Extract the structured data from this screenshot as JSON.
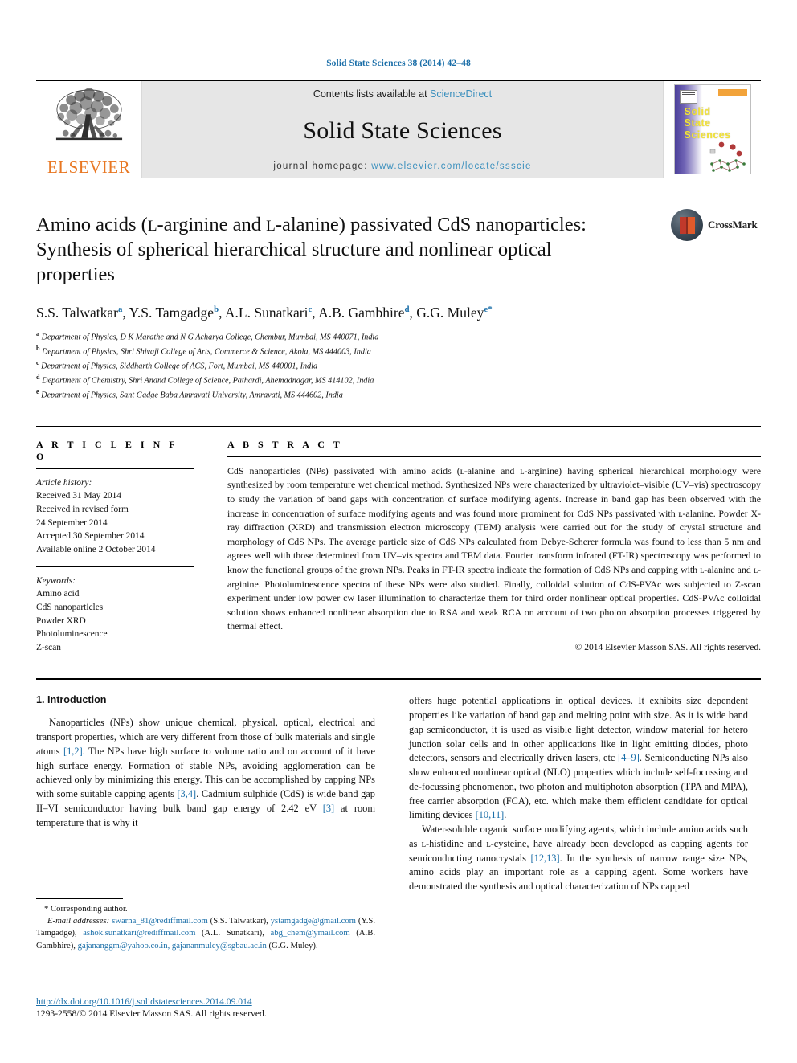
{
  "running_head": "Solid State Sciences 38 (2014) 42–48",
  "masthead": {
    "publisher_name": "ELSEVIER",
    "contents_prefix": "Contents lists available at ",
    "contents_link": "ScienceDirect",
    "journal_title": "Solid State Sciences",
    "homepage_label": "journal homepage:",
    "homepage_url": "www.elsevier.com/locate/ssscie",
    "cover_title": "Solid State Sciences"
  },
  "crossmark": {
    "label": "CrossMark"
  },
  "article": {
    "title_line1": "Amino acids (",
    "title_smallcap1": "L",
    "title_line1b": "-arginine and ",
    "title_smallcap2": "L",
    "title_line1c": "-alanine) passivated CdS nanoparticles:",
    "title_line2": "Synthesis of spherical hierarchical structure and nonlinear optical",
    "title_line3": "properties",
    "authors": [
      {
        "name": "S.S. Talwatkar",
        "mark": "a"
      },
      {
        "name": "Y.S. Tamgadge",
        "mark": "b"
      },
      {
        "name": "A.L. Sunatkari",
        "mark": "c"
      },
      {
        "name": "A.B. Gambhire",
        "mark": "d"
      },
      {
        "name": "G.G. Muley",
        "mark": "e",
        "star": "*"
      }
    ],
    "affiliations": [
      {
        "mark": "a",
        "text": "Department of Physics, D K Marathe and N G Acharya College, Chembur, Mumbai, MS 440071, India"
      },
      {
        "mark": "b",
        "text": "Department of Physics, Shri Shivaji College of Arts, Commerce & Science, Akola, MS 444003, India"
      },
      {
        "mark": "c",
        "text": "Department of Physics, Siddharth College of ACS, Fort, Mumbai, MS 440001, India"
      },
      {
        "mark": "d",
        "text": "Department of Chemistry, Shri Anand College of Science, Pathardi, Ahemadnagar, MS 414102, India"
      },
      {
        "mark": "e",
        "text": "Department of Physics, Sant Gadge Baba Amravati University, Amravati, MS 444602, India"
      }
    ]
  },
  "article_info": {
    "heading": "A R T I C L E   I N F O",
    "history_label": "Article history:",
    "history": [
      "Received 31 May 2014",
      "Received in revised form",
      "24 September 2014",
      "Accepted 30 September 2014",
      "Available online 2 October 2014"
    ],
    "keywords_label": "Keywords:",
    "keywords": [
      "Amino acid",
      "CdS nanoparticles",
      "Powder XRD",
      "Photoluminescence",
      "Z-scan"
    ]
  },
  "abstract": {
    "heading": "A B S T R A C T",
    "text": "CdS nanoparticles (NPs) passivated with amino acids (ʟ-alanine and ʟ-arginine) having spherical hierarchical morphology were synthesized by room temperature wet chemical method. Synthesized NPs were characterized by ultraviolet–visible (UV–vis) spectroscopy to study the variation of band gaps with concentration of surface modifying agents. Increase in band gap has been observed with the increase in concentration of surface modifying agents and was found more prominent for CdS NPs passivated with ʟ-alanine. Powder X-ray diffraction (XRD) and transmission electron microscopy (TEM) analysis were carried out for the study of crystal structure and morphology of CdS NPs. The average particle size of CdS NPs calculated from Debye-Scherer formula was found to less than 5 nm and agrees well with those determined from UV–vis spectra and TEM data. Fourier transform infrared (FT-IR) spectroscopy was performed to know the functional groups of the grown NPs. Peaks in FT-IR spectra indicate the formation of CdS NPs and capping with ʟ-alanine and ʟ-arginine. Photoluminescence spectra of these NPs were also studied. Finally, colloidal solution of CdS-PVAc was subjected to Z-scan experiment under low power cw laser illumination to characterize them for third order nonlinear optical properties. CdS-PVAc colloidal solution shows enhanced nonlinear absorption due to RSA and weak RCA on account of two photon absorption processes triggered by thermal effect.",
    "copyright": "© 2014 Elsevier Masson SAS. All rights reserved."
  },
  "body": {
    "section_number_title": "1.  Introduction",
    "left_p1_a": "Nanoparticles (NPs) show unique chemical, physical, optical, electrical and transport properties, which are very different from those of bulk materials and single atoms ",
    "left_p1_ref1": "[1,2]",
    "left_p1_b": ". The NPs have high surface to volume ratio and on account of it have high surface energy. Formation of stable NPs, avoiding agglomeration can be achieved only by minimizing this energy. This can be accomplished by capping NPs with some suitable capping agents ",
    "left_p1_ref2": "[3,4]",
    "left_p1_c": ". Cadmium sulphide (CdS) is wide band gap II–VI semiconductor having bulk band gap energy of 2.42 eV ",
    "left_p1_ref3": "[3]",
    "left_p1_d": " at room temperature that is why it",
    "right_p1_a": "offers huge potential applications in optical devices. It exhibits size dependent properties like variation of band gap and melting point with size. As it is wide band gap semiconductor, it is used as visible light detector, window material for hetero junction solar cells and in other applications like in light emitting diodes, photo detectors, sensors and electrically driven lasers, etc ",
    "right_p1_ref1": "[4–9]",
    "right_p1_b": ". Semiconducting NPs also show enhanced nonlinear optical (NLO) properties which include self-focussing and de-focussing phenomenon, two photon and multiphoton absorption (TPA and MPA), free carrier absorption (FCA), etc. which make them efficient candidate for optical limiting devices ",
    "right_p1_ref2": "[10,11]",
    "right_p1_c": ".",
    "right_p2_a": "Water-soluble organic surface modifying agents, which include amino acids such as ʟ-histidine and ʟ-cysteine, have already been developed as capping agents for semiconducting nanocrystals ",
    "right_p2_ref1": "[12,13]",
    "right_p2_b": ". In the synthesis of narrow range size NPs, amino acids play an important role as a capping agent. Some workers have demonstrated the synthesis and optical characterization of NPs capped"
  },
  "footer": {
    "corresponding_star": "*",
    "corresponding_label": "Corresponding author.",
    "email_label": "E-mail addresses:",
    "emails": [
      {
        "addr": "swarna_81@rediffmail.com",
        "who": " (S.S. Talwatkar), "
      },
      {
        "addr": "ystamgadge@gmail.com",
        "who": " (Y.S. Tamgadge), "
      },
      {
        "addr": "ashok.sunatkari@rediffmail.com",
        "who": " (A.L. Sunatkari), "
      },
      {
        "addr": "abg_chem@ymail.com",
        "who": " (A.B. Gambhire), "
      },
      {
        "addr": "gajananggm@yahoo.co.in,",
        "who": " "
      },
      {
        "addr": "gajananmuley@sgbau.ac.in",
        "who": " (G.G. Muley)."
      }
    ],
    "doi_url": "http://dx.doi.org/10.1016/j.solidstatesciences.2014.09.014",
    "issn_line": "1293-2558/© 2014 Elsevier Masson SAS. All rights reserved."
  },
  "colors": {
    "link_blue": "#1a6ea8",
    "elsevier_orange": "#E87722",
    "masthead_gray": "#e6e6e6"
  }
}
